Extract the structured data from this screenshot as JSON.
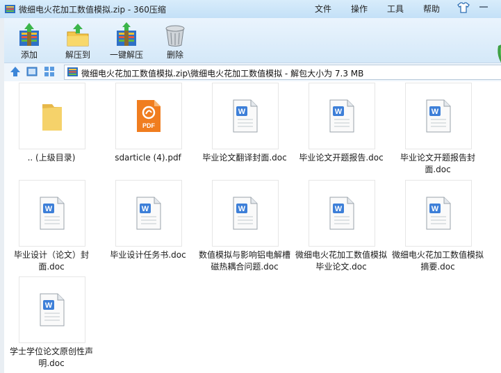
{
  "window": {
    "title": "微细电火花加工数值模拟.zip - 360压缩",
    "menu": [
      "文件",
      "操作",
      "工具",
      "帮助"
    ]
  },
  "toolbar": {
    "buttons": [
      {
        "label": "添加",
        "icon": "add-archive-icon"
      },
      {
        "label": "解压到",
        "icon": "extract-folder-icon"
      },
      {
        "label": "一键解压",
        "icon": "one-click-extract-icon"
      },
      {
        "label": "删除",
        "icon": "trash-can-icon"
      }
    ]
  },
  "address": {
    "path": "微细电火花加工数值模拟.zip\\微细电火花加工数值模拟 - 解包大小为 7.3 MB"
  },
  "files": [
    {
      "name": ".. (上级目录)",
      "type": "folder"
    },
    {
      "name": "sdarticle (4).pdf",
      "type": "pdf"
    },
    {
      "name": "毕业论文翻译封面.doc",
      "type": "doc"
    },
    {
      "name": "毕业论文开题报告.doc",
      "type": "doc"
    },
    {
      "name": "毕业论文开题报告封面.doc",
      "type": "doc"
    },
    {
      "name": "毕业设计（论文）封面.doc",
      "type": "doc"
    },
    {
      "name": "毕业设计任务书.doc",
      "type": "doc"
    },
    {
      "name": "数值模拟与影响铝电解槽磁热耦合问题.doc",
      "type": "doc"
    },
    {
      "name": "微细电火花加工数值模拟毕业论文.doc",
      "type": "doc"
    },
    {
      "name": "微细电火花加工数值模拟摘要.doc",
      "type": "doc"
    },
    {
      "name": "学士学位论文原创性声明.doc",
      "type": "doc"
    }
  ]
}
